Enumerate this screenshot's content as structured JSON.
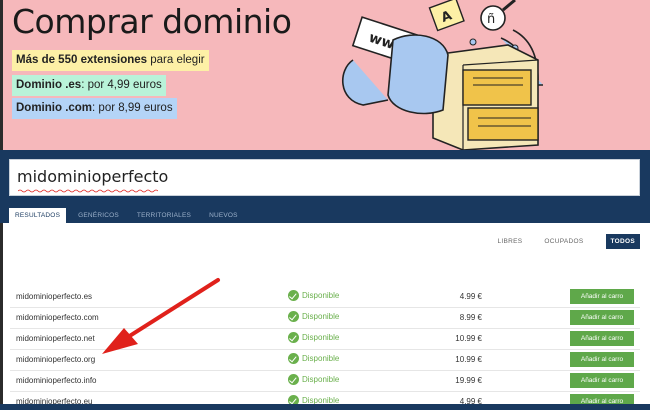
{
  "hero": {
    "title": "Comprar dominio",
    "chips": [
      {
        "strong": "Más de 550 extensiones",
        "rest": " para elegir"
      },
      {
        "strong": "Dominio .es",
        "rest": ": por 4,99 euros"
      },
      {
        "strong": "Dominio .com",
        "rest": ": por 8,99 euros"
      }
    ],
    "illustration_text": {
      "sign": "www.",
      "card_a": "A",
      "card_b": "ñ"
    },
    "colors": {
      "background": "#f6b8bb",
      "chip_yellow": "#fdf0a6",
      "chip_green": "#b9f3d9",
      "chip_blue": "#b4d4f7"
    }
  },
  "search": {
    "value": "midominioperfecto",
    "tabs": [
      "RESULTADOS",
      "GENÉRICOS",
      "TERRITORIALES",
      "NUEVOS"
    ],
    "active_tab": "RESULTADOS"
  },
  "filters": {
    "items": [
      "LIBRES",
      "OCUPADOS",
      "TODOS"
    ],
    "active": "TODOS"
  },
  "results": [
    {
      "name": "midominioperfecto",
      "ext": ".es",
      "status": "Disponible",
      "price": "4.99 €",
      "button": "Añadir al carro"
    },
    {
      "name": "midominioperfecto",
      "ext": ".com",
      "status": "Disponible",
      "price": "8.99 €",
      "button": "Añadir al carro"
    },
    {
      "name": "midominioperfecto",
      "ext": ".net",
      "status": "Disponible",
      "price": "10.99 €",
      "button": "Añadir al carro"
    },
    {
      "name": "midominioperfecto",
      "ext": ".org",
      "status": "Disponible",
      "price": "10.99 €",
      "button": "Añadir al carro"
    },
    {
      "name": "midominioperfecto",
      "ext": ".info",
      "status": "Disponible",
      "price": "19.99 €",
      "button": "Añadir al carro"
    },
    {
      "name": "midominioperfecto",
      "ext": ".eu",
      "status": "Disponible",
      "price": "4.99 €",
      "button": "Añadir al carro"
    }
  ],
  "theme": {
    "navy": "#19395f",
    "green": "#5fa84a",
    "status_green": "#6ab04c",
    "arrow_red": "#e0211b"
  },
  "icons": {
    "status": "check-circle-icon",
    "annotation": "red-arrow-icon"
  }
}
